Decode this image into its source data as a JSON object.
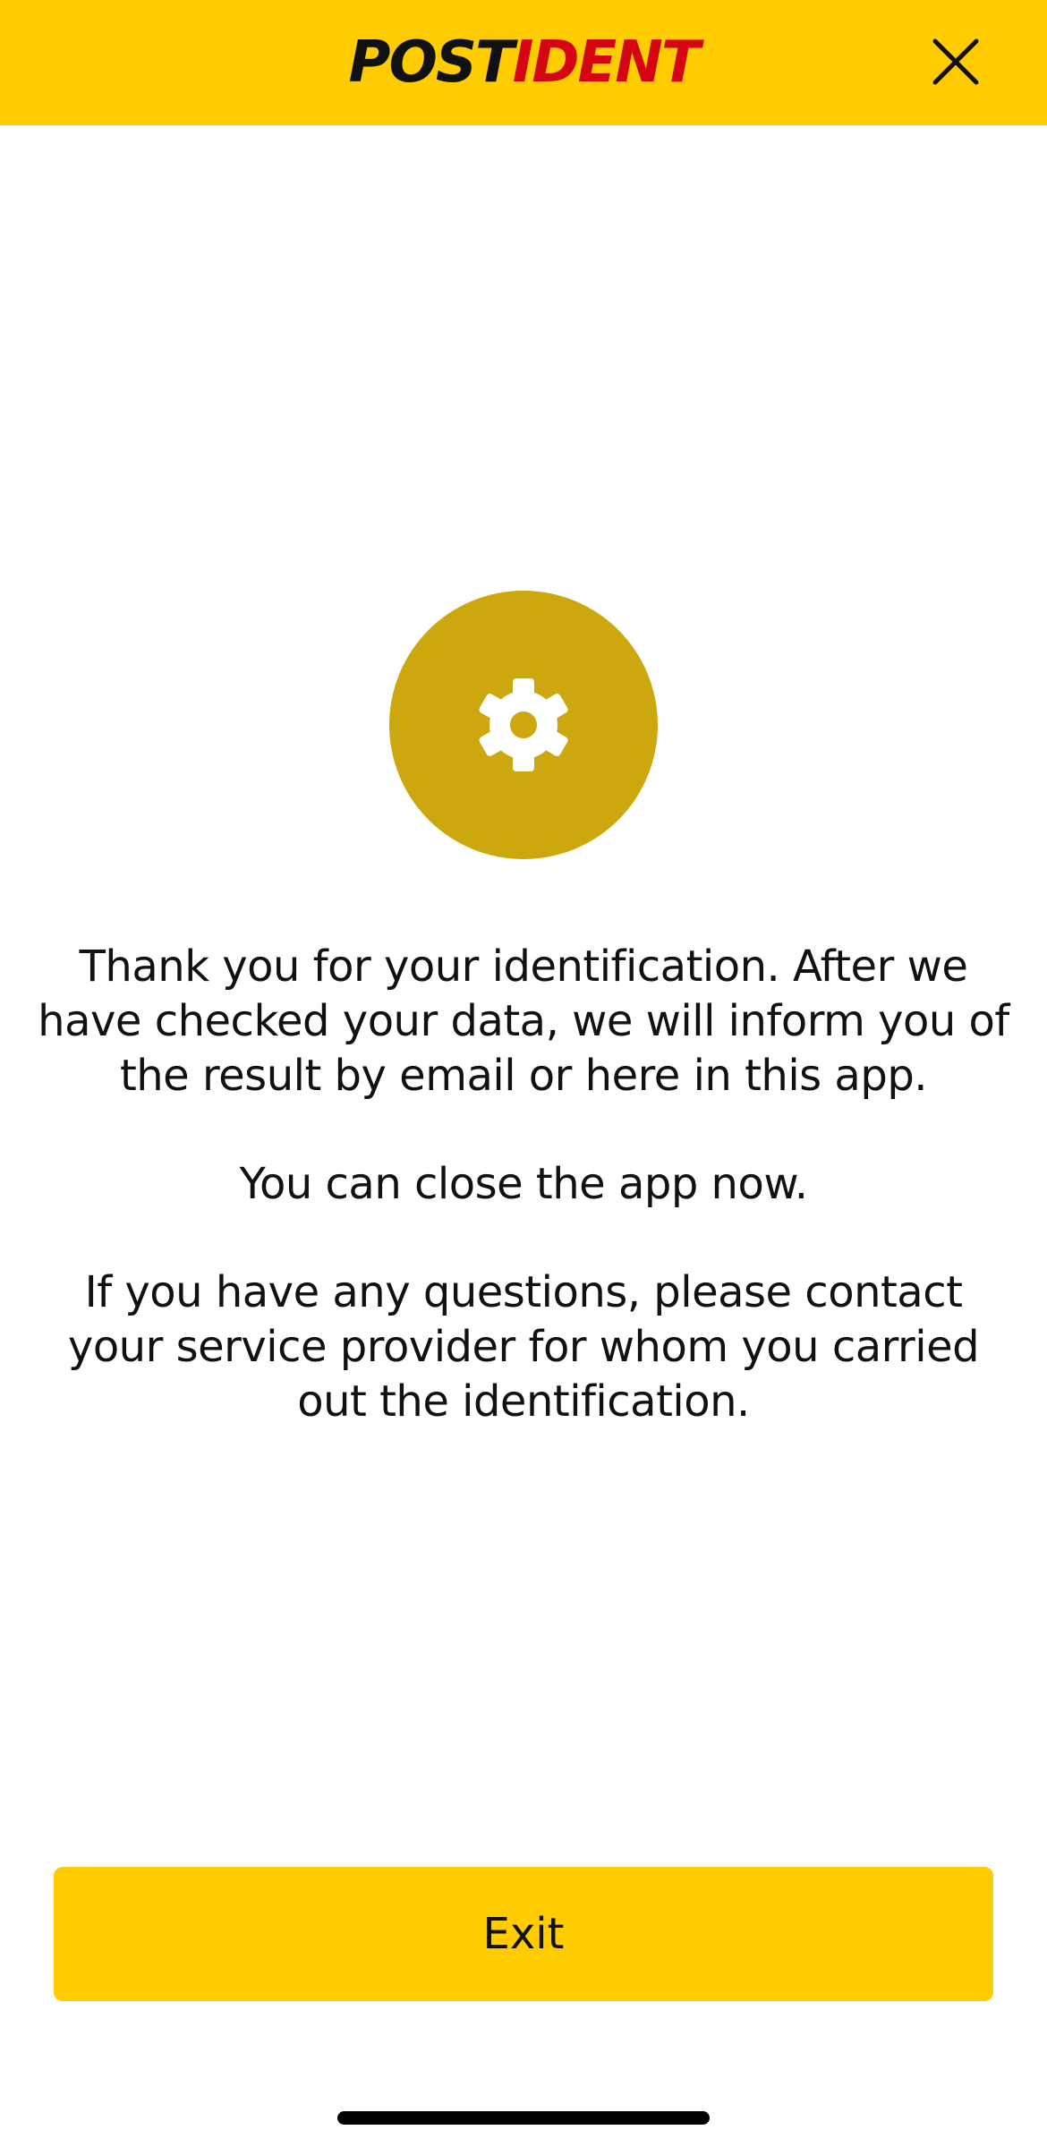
{
  "header": {
    "logo_part1": "POST",
    "logo_part2": "IDENT",
    "close_icon": "close-icon",
    "background_color": "#FECC00",
    "logo_accent_color": "#D40511"
  },
  "status": {
    "icon": "gear-icon",
    "circle_color": "#CDA70E"
  },
  "message": {
    "paragraph1": "Thank you for your identification. After we have checked your data, we will inform you of the result by email or here in this app.",
    "paragraph2": "You can close the app now.",
    "paragraph3": "If you have any questions, please contact your service provider for whom you carried out the identification."
  },
  "footer": {
    "exit_label": "Exit"
  }
}
